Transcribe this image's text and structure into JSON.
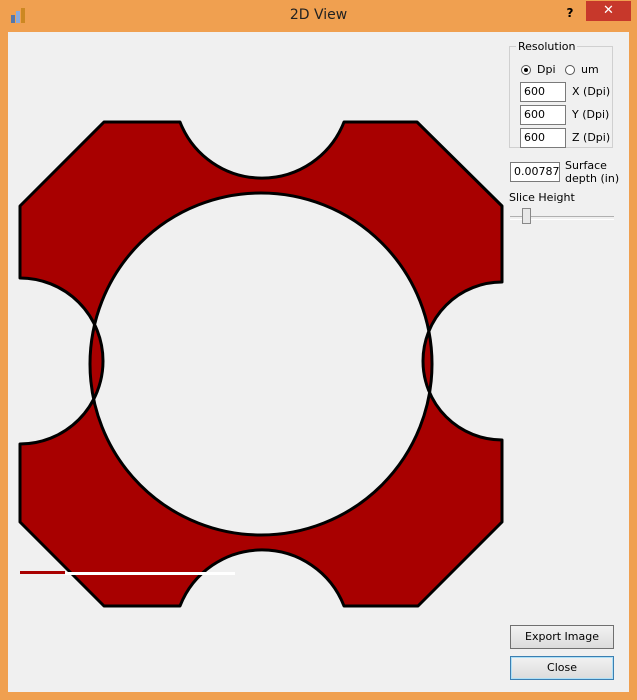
{
  "window": {
    "title": "2D View",
    "help_label": "?",
    "close_label": "✕",
    "app_icon": "app-logo-icon"
  },
  "resolution": {
    "group_label": "Resolution",
    "dpi_label": "Dpi",
    "um_label": "um",
    "selected": "Dpi",
    "x_value": "600",
    "x_label": "X (Dpi)",
    "y_value": "600",
    "y_label": "Y (Dpi)",
    "z_value": "600",
    "z_label": "Z (Dpi)"
  },
  "surface": {
    "value": "0.00787",
    "label_line1": "Surface",
    "label_line2": "depth (in)"
  },
  "slice": {
    "label": "Slice Height",
    "level": 0.18
  },
  "buttons": {
    "export_label": "Export Image",
    "close_label": "Close"
  },
  "colors": {
    "shape_fill": "#a80000",
    "window_border": "#f0a050",
    "close_button": "#c7382b"
  }
}
